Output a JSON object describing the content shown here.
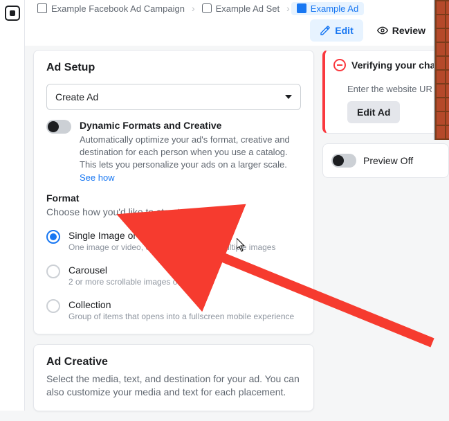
{
  "breadcrumbs": {
    "campaign": "Example Facebook Ad Campaign",
    "adset": "Example Ad Set",
    "ad": "Example Ad"
  },
  "topActions": {
    "edit": "Edit",
    "review": "Review"
  },
  "adSetup": {
    "heading": "Ad Setup",
    "selectValue": "Create Ad",
    "dynamic": {
      "title": "Dynamic Formats and Creative",
      "desc": "Automatically optimize your ad's format, creative and destination for each person when you use a catalog. This lets you personalize your ads on a larger scale.",
      "link": "See how"
    },
    "format": {
      "label": "Format",
      "sub": "Choose how you'd like to structure your ad.",
      "options": [
        {
          "title": "Single Image or Video",
          "desc": "One image or video, or a slideshow with multiple images"
        },
        {
          "title": "Carousel",
          "desc": "2 or more scrollable images or videos"
        },
        {
          "title": "Collection",
          "desc": "Group of items that opens into a fullscreen mobile experience"
        }
      ]
    }
  },
  "adCreative": {
    "heading": "Ad Creative",
    "desc": "Select the media, text, and destination for your ad. You can also customize your media and text for each placement."
  },
  "verify": {
    "heading": "Verifying your chang",
    "sub": "Enter the website UR",
    "button": "Edit Ad"
  },
  "preview": {
    "label": "Preview Off"
  },
  "colors": {
    "accent": "#1877f2",
    "danger": "#fa383e"
  }
}
